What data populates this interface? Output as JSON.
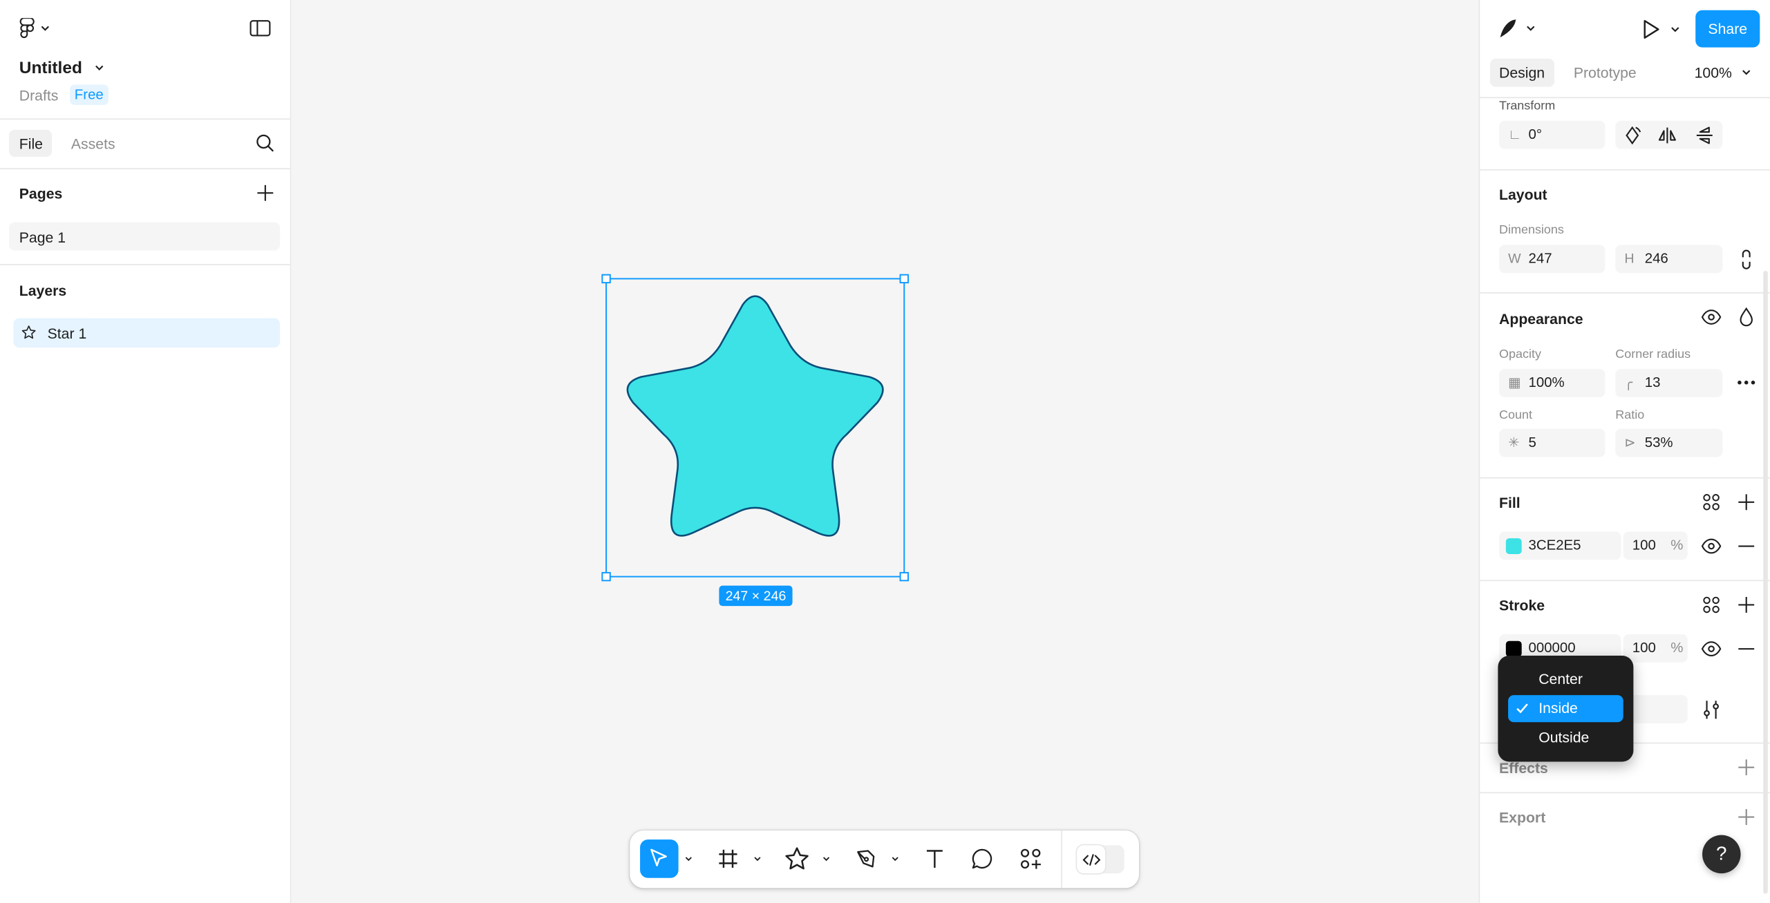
{
  "file": {
    "title": "Untitled",
    "location": "Drafts",
    "plan": "Free"
  },
  "left_tabs": {
    "file": "File",
    "assets": "Assets"
  },
  "pages": {
    "title": "Pages",
    "items": [
      {
        "label": "Page 1"
      }
    ]
  },
  "layers": {
    "title": "Layers",
    "items": [
      {
        "label": "Star 1",
        "icon": "star-outline-icon"
      }
    ]
  },
  "canvas": {
    "selection_size": "247 × 246",
    "star_fill": "#3CE2E5",
    "selection_color": "#0d99ff"
  },
  "header_right": {
    "share": "Share",
    "zoom": "100%"
  },
  "right_tabs": {
    "design": "Design",
    "prototype": "Prototype"
  },
  "transform": {
    "title": "Transform",
    "rotation": "0°"
  },
  "layout": {
    "title": "Layout",
    "dimensions_label": "Dimensions",
    "w_label": "W",
    "w": "247",
    "h_label": "H",
    "h": "246"
  },
  "appearance": {
    "title": "Appearance",
    "opacity_label": "Opacity",
    "opacity": "100%",
    "corner_radius_label": "Corner radius",
    "corner_radius": "13",
    "count_label": "Count",
    "count": "5",
    "ratio_label": "Ratio",
    "ratio": "53%"
  },
  "fill": {
    "title": "Fill",
    "hex": "3CE2E5",
    "opacity": "100",
    "unit": "%",
    "color": "#3CE2E5"
  },
  "stroke": {
    "title": "Stroke",
    "hex": "000000",
    "opacity": "100",
    "unit": "%",
    "color": "#000000"
  },
  "stroke_position_menu": {
    "options": [
      "Center",
      "Inside",
      "Outside"
    ],
    "selected": "Inside"
  },
  "effects": {
    "title": "Effects"
  },
  "export": {
    "title": "Export"
  },
  "help": {
    "label": "?"
  },
  "colors": {
    "accent": "#0d99ff",
    "dark_menu": "#1e1e1e"
  }
}
